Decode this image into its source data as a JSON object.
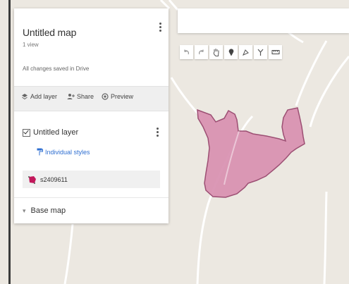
{
  "map": {
    "title": "Untitled map",
    "views": "1 view",
    "save_status": "All changes saved in Drive",
    "actions": {
      "add_layer": "Add layer",
      "share": "Share",
      "preview": "Preview"
    },
    "layer": {
      "name": "Untitled layer",
      "checked": true,
      "style_link": "Individual styles",
      "features": [
        {
          "name": "s2409611",
          "color": "#c2185b"
        }
      ]
    },
    "base_map": "Base map"
  },
  "toolbar": {
    "tools": [
      "undo-icon",
      "redo-icon",
      "hand-icon",
      "marker-icon",
      "draw-line-icon",
      "route-icon",
      "ruler-icon"
    ]
  },
  "colors": {
    "polygon_fill": "#d88fb0",
    "polygon_stroke": "#9c4f73",
    "road": "#ffffff",
    "map_bg": "#ece8e1",
    "link": "#2f6fd1"
  }
}
